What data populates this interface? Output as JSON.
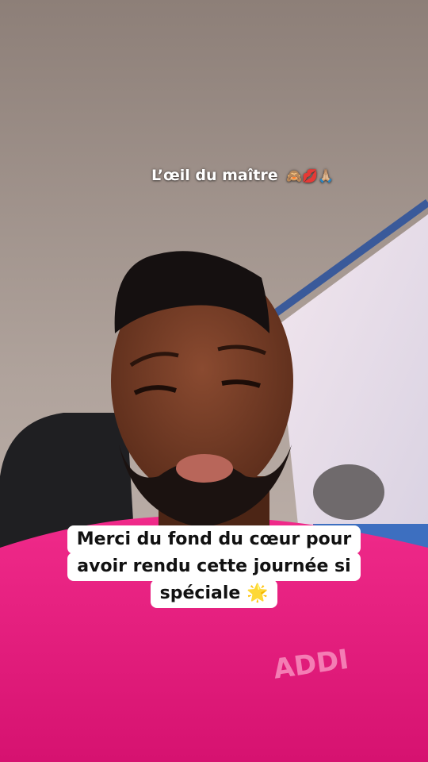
{
  "top_caption": {
    "text": "L’œil du maître",
    "emoji": "🙈💋🙏🏼"
  },
  "bottom_caption": {
    "lines": [
      "Merci du fond du cœur pour",
      "avoir rendu cette journée si",
      "spéciale 🌟"
    ]
  },
  "colors": {
    "caption_background": "#ffffff",
    "caption_text": "#111111",
    "shirt": "#e3187a",
    "car_ceiling": "#a89a92"
  }
}
